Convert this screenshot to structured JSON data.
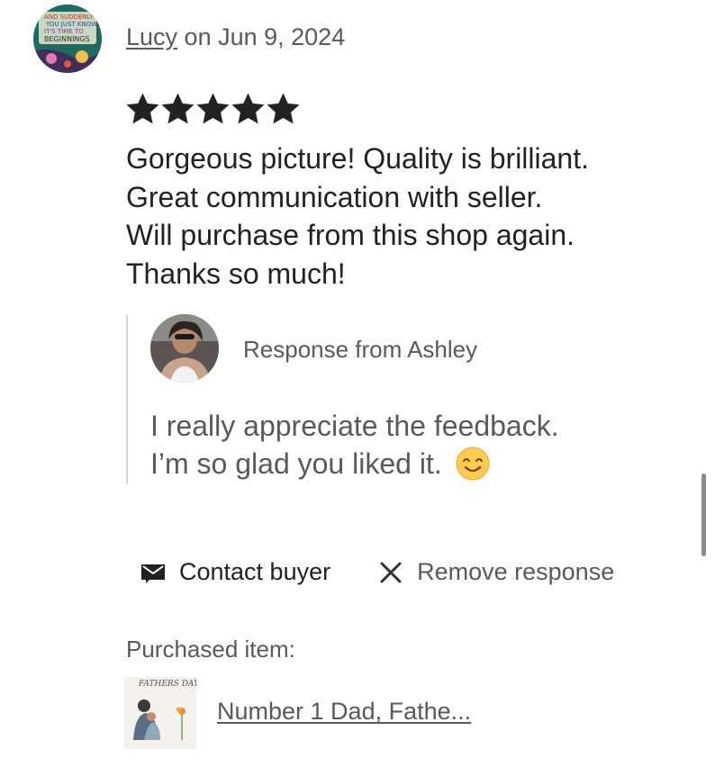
{
  "review": {
    "reviewer_name": "Lucy",
    "date_text": " on Jun 9, 2024",
    "rating": 5,
    "rating_max": 5,
    "text_lines": [
      "Gorgeous picture! Quality is brilliant.",
      "Great communication with seller.",
      "Will purchase from this shop again.",
      "Thanks so much!"
    ]
  },
  "response": {
    "title": "Response from Ashley",
    "text_lines": [
      "I really appreciate the feedback.",
      "I’m so glad you liked it."
    ],
    "emoji": "smiling-face-icon"
  },
  "actions": {
    "contact_label": "Contact buyer",
    "contact_icon": "envelope-icon",
    "remove_label": "Remove response",
    "remove_icon": "close-icon"
  },
  "purchased": {
    "label": "Purchased item:",
    "item_title": "Number 1 Dad, Fathe...",
    "thumb_text": "FATHERS DAY"
  },
  "colors": {
    "text_primary": "#222222",
    "text_secondary": "#595959",
    "star": "#222222",
    "divider": "#d9d9d9"
  }
}
